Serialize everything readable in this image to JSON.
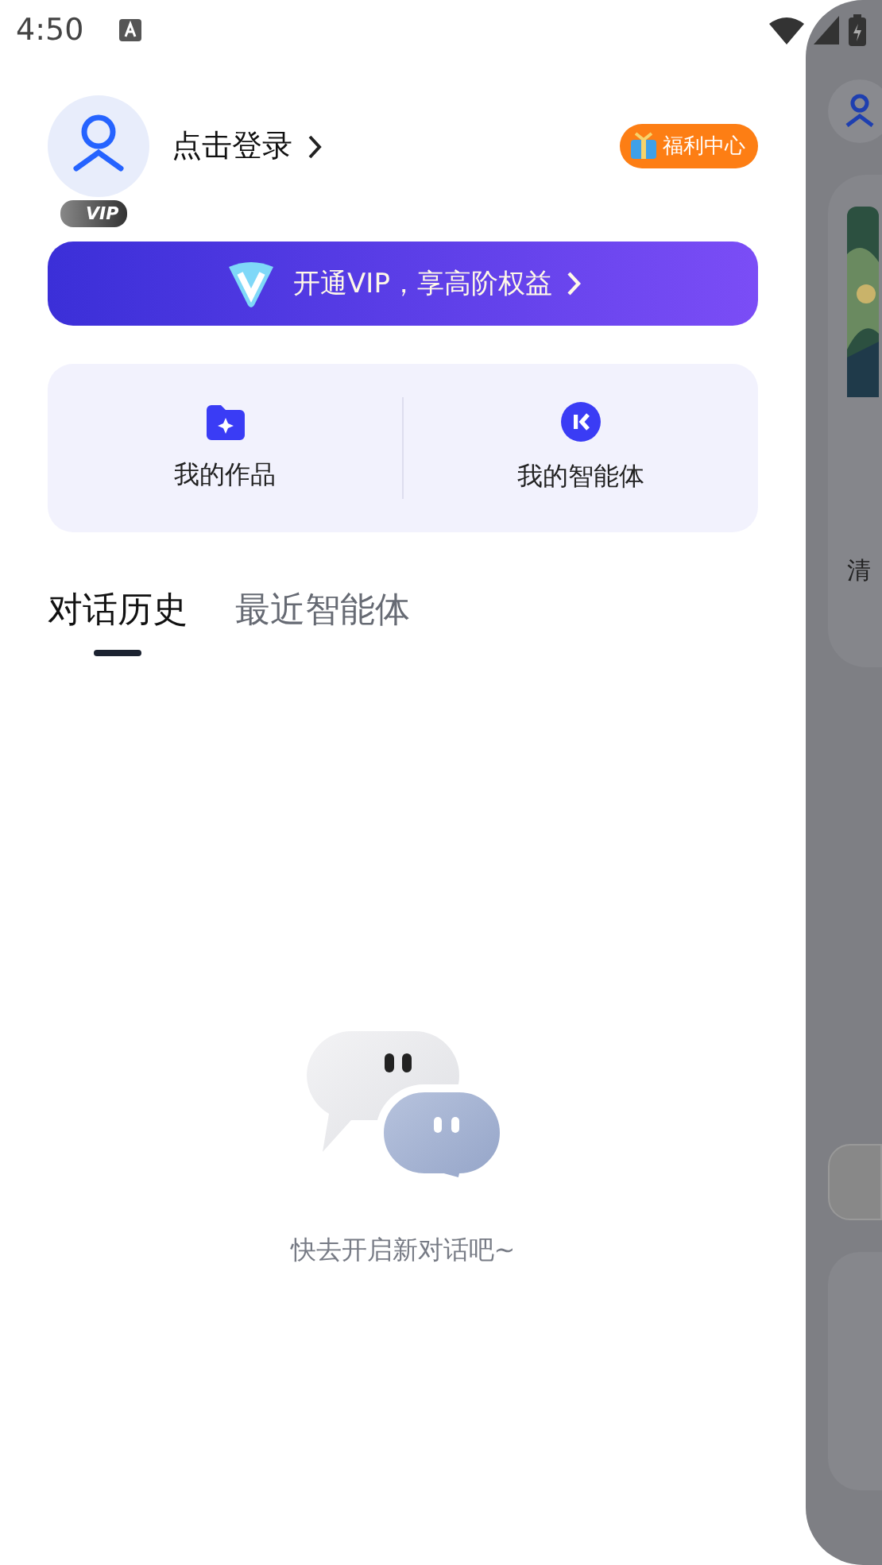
{
  "status_bar": {
    "time": "4:50"
  },
  "profile": {
    "login_label": "点击登录",
    "vip_tag": "VIP",
    "welfare_badge": "福利中心"
  },
  "vip_banner": {
    "text": "开通VIP，享高阶权益"
  },
  "shortcuts": [
    {
      "kind": "folder",
      "label": "我的作品"
    },
    {
      "kind": "agent",
      "label": "我的智能体"
    }
  ],
  "tabs": [
    {
      "label": "对话历史",
      "selected": true
    },
    {
      "label": "最近智能体",
      "selected": false
    }
  ],
  "empty_state": {
    "text": "快去开启新对话吧~"
  },
  "backdrop": {
    "label": "清"
  }
}
